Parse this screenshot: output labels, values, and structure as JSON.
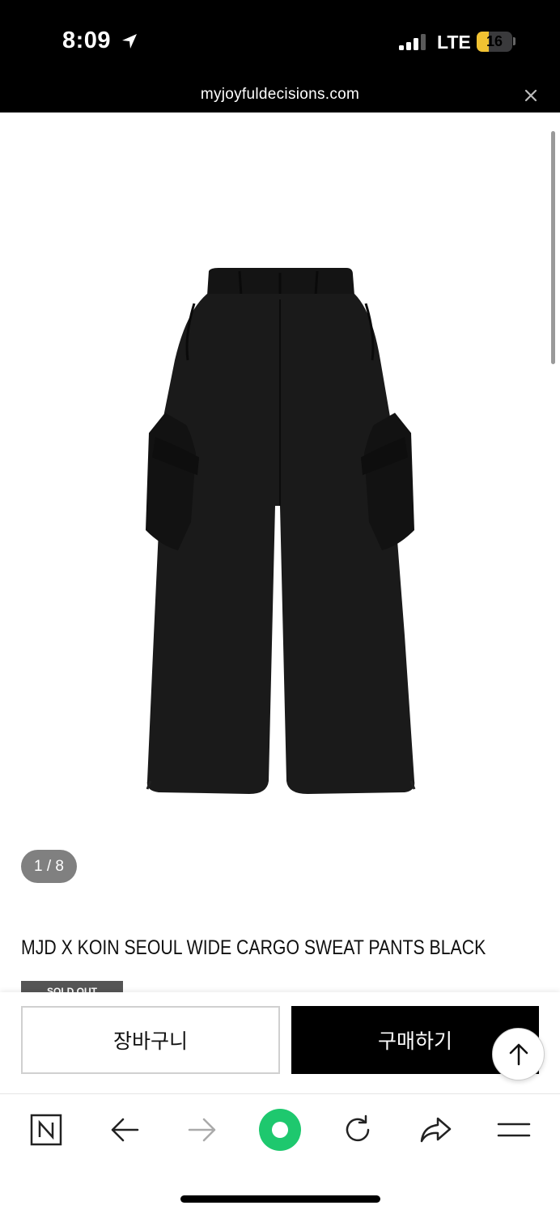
{
  "status_bar": {
    "time": "8:09",
    "network": "LTE",
    "battery_level": "16",
    "battery_fraction": 0.16,
    "icons": [
      "location-arrow-icon",
      "signal-bars-icon",
      "battery-icon"
    ]
  },
  "browser": {
    "url": "myjoyfuldecisions.com",
    "close_icon": "close-icon"
  },
  "product": {
    "image_counter": "1 / 8",
    "title": "MJD X KOIN SEOUL WIDE CARGO SWEAT PANTS BLACK",
    "sold_out_label": "SOLD OUT",
    "image_subject": "black wide cargo sweat pants"
  },
  "purchase_bar": {
    "cart_label": "장바구니",
    "buy_label": "구매하기",
    "top_icon": "arrow-up-icon"
  },
  "toolbar": {
    "items": [
      "naver-n-icon",
      "back-arrow-icon",
      "forward-arrow-icon",
      "green-dot-icon",
      "reload-icon",
      "share-icon",
      "menu-icon"
    ]
  },
  "colors": {
    "status_bg": "#000000",
    "battery_yellow": "#f1c232",
    "buy_button_bg": "#000000",
    "green_dot": "#1ec86e",
    "counter_bg": "#808080"
  }
}
